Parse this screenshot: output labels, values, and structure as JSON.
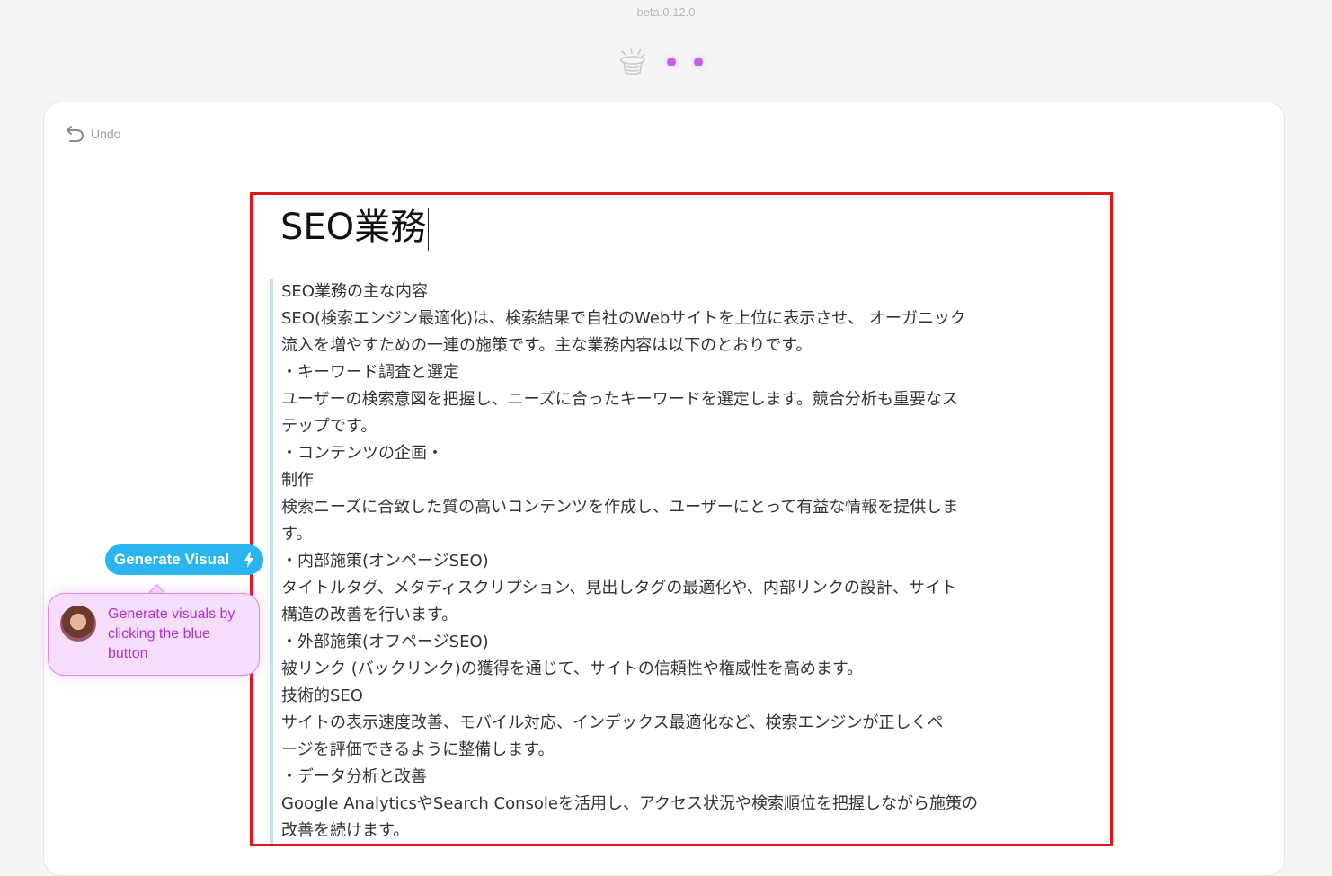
{
  "app": {
    "version": "beta.0.12.0"
  },
  "toolbar": {
    "undo_label": "Undo"
  },
  "document": {
    "title": "SEO業務",
    "lines": [
      "SEO業務の主な内容",
      "SEO(検索エンジン最適化)は、検索結果で自社のWebサイトを上位に表示させ、 オーガニック",
      "流入を増やすための一連の施策です。主な業務内容は以下のとおりです。",
      "・キーワード調査と選定",
      "ユーザーの検索意図を把握し、ニーズに合ったキーワードを選定します。競合分析も重要なス",
      "テップです。",
      "・コンテンツの企画・",
      "制作",
      "検索ニーズに合致した質の高いコンテンツを作成し、ユーザーにとって有益な情報を提供しま",
      "す。",
      "・内部施策(オンページSEO)",
      "タイトルタグ、メタディスクリプション、見出しタグの最適化や、内部リンクの設計、サイト",
      "構造の改善を行います。",
      "・外部施策(オフページSEO)",
      "被リンク (バックリンク)の獲得を通じて、サイトの信頼性や権威性を高めます。",
      "技術的SEO",
      "サイトの表示速度改善、モバイル対応、インデックス最適化など、検索エンジンが正しくペ",
      "ージを評価できるように整備します。",
      "・データ分析と改善",
      "Google AnalyticsやSearch Consoleを活用し、アクセス状況や検索順位を把握しながら施策の",
      "改善を続けます。"
    ]
  },
  "generate": {
    "button_label": "Generate Visual",
    "tooltip_text": "Generate visuals by clicking the blue button"
  },
  "colors": {
    "accent_blue": "#2ab4f0",
    "accent_purple": "#c45ff0",
    "tooltip_bg": "#f7ddfc",
    "selection_border": "#e0161b"
  },
  "icons": {
    "logo": "magic-hat-icon",
    "undo": "undo-arrow-icon",
    "bolt": "lightning-icon"
  }
}
